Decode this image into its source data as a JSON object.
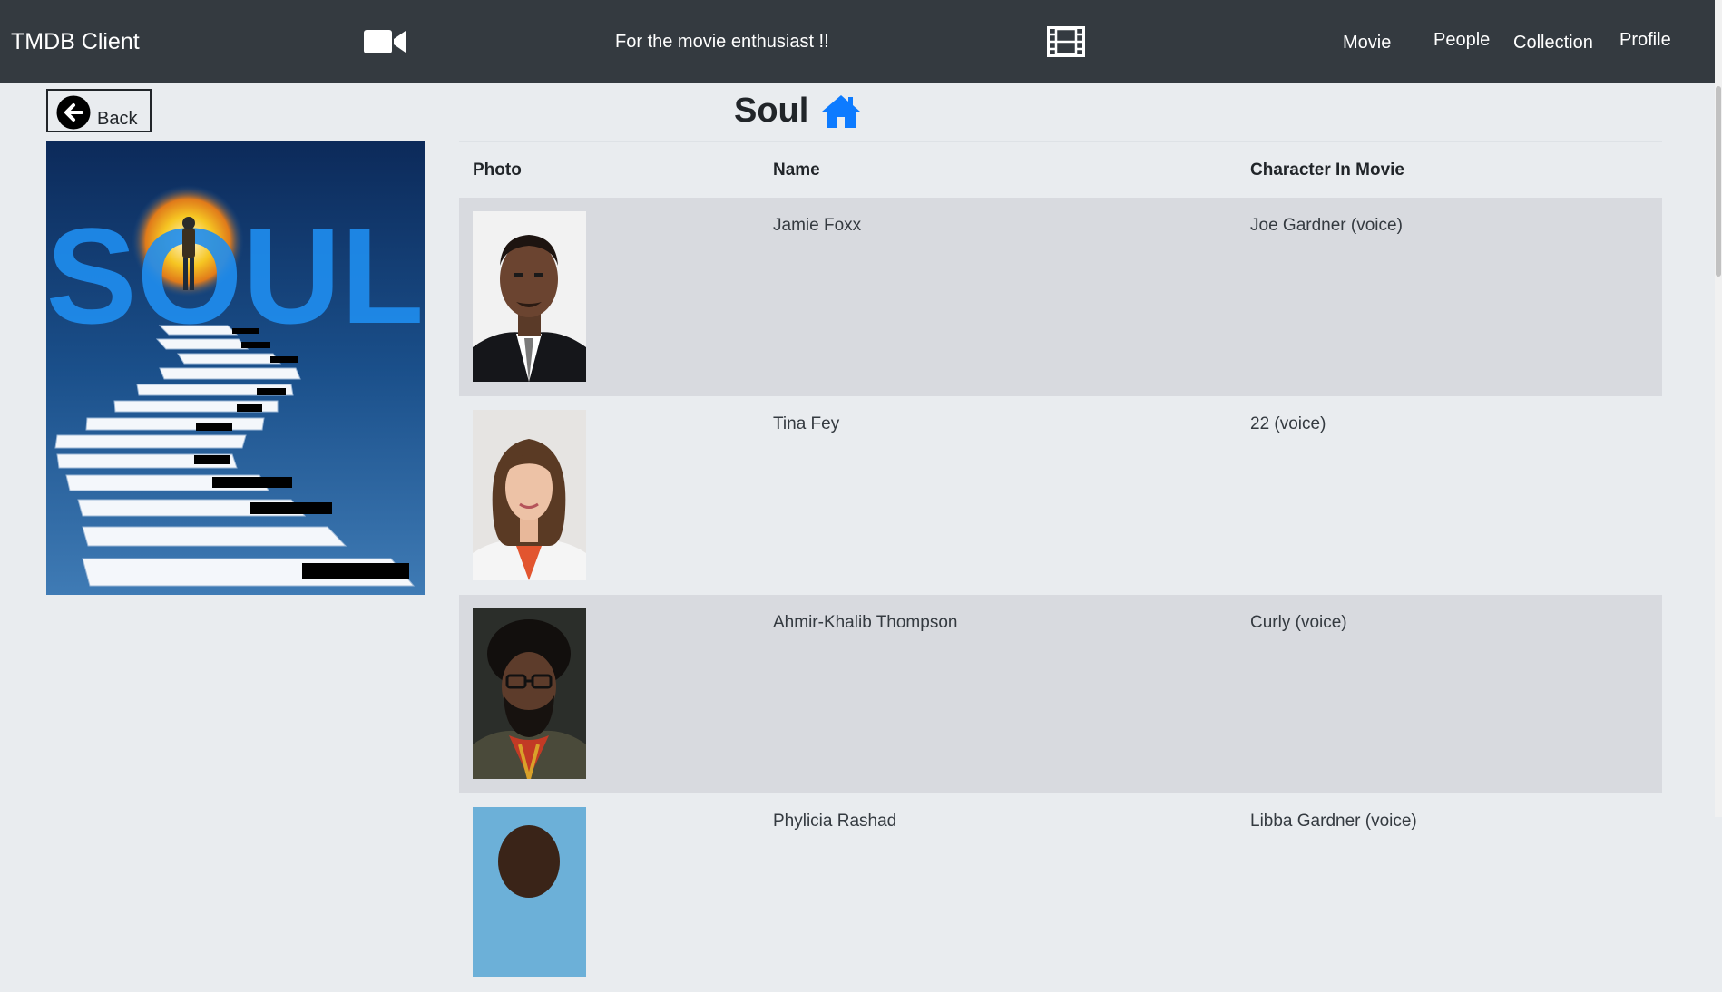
{
  "navbar": {
    "brand": "TMDB Client",
    "tagline": "For the movie enthusiast !!",
    "camera_icon": "video-camera-icon",
    "film_icon": "film-strip-icon",
    "links": [
      "Movie",
      "People",
      "Collection",
      "Profile"
    ]
  },
  "back": {
    "label": "Back",
    "icon": "arrow-left-circle-icon"
  },
  "poster": {
    "title_art": "SOUL"
  },
  "movie": {
    "title": "Soul",
    "home_icon": "home-icon",
    "accent": "#0d7bff"
  },
  "table": {
    "headers": [
      "Photo",
      "Name",
      "Character In Movie"
    ],
    "rows": [
      {
        "name": "Jamie Foxx",
        "character": "Joe Gardner (voice)"
      },
      {
        "name": "Tina Fey",
        "character": "22 (voice)"
      },
      {
        "name": "Ahmir-Khalib Thompson",
        "character": "Curly (voice)"
      },
      {
        "name": "Phylicia Rashad",
        "character": "Libba Gardner (voice)"
      }
    ]
  }
}
